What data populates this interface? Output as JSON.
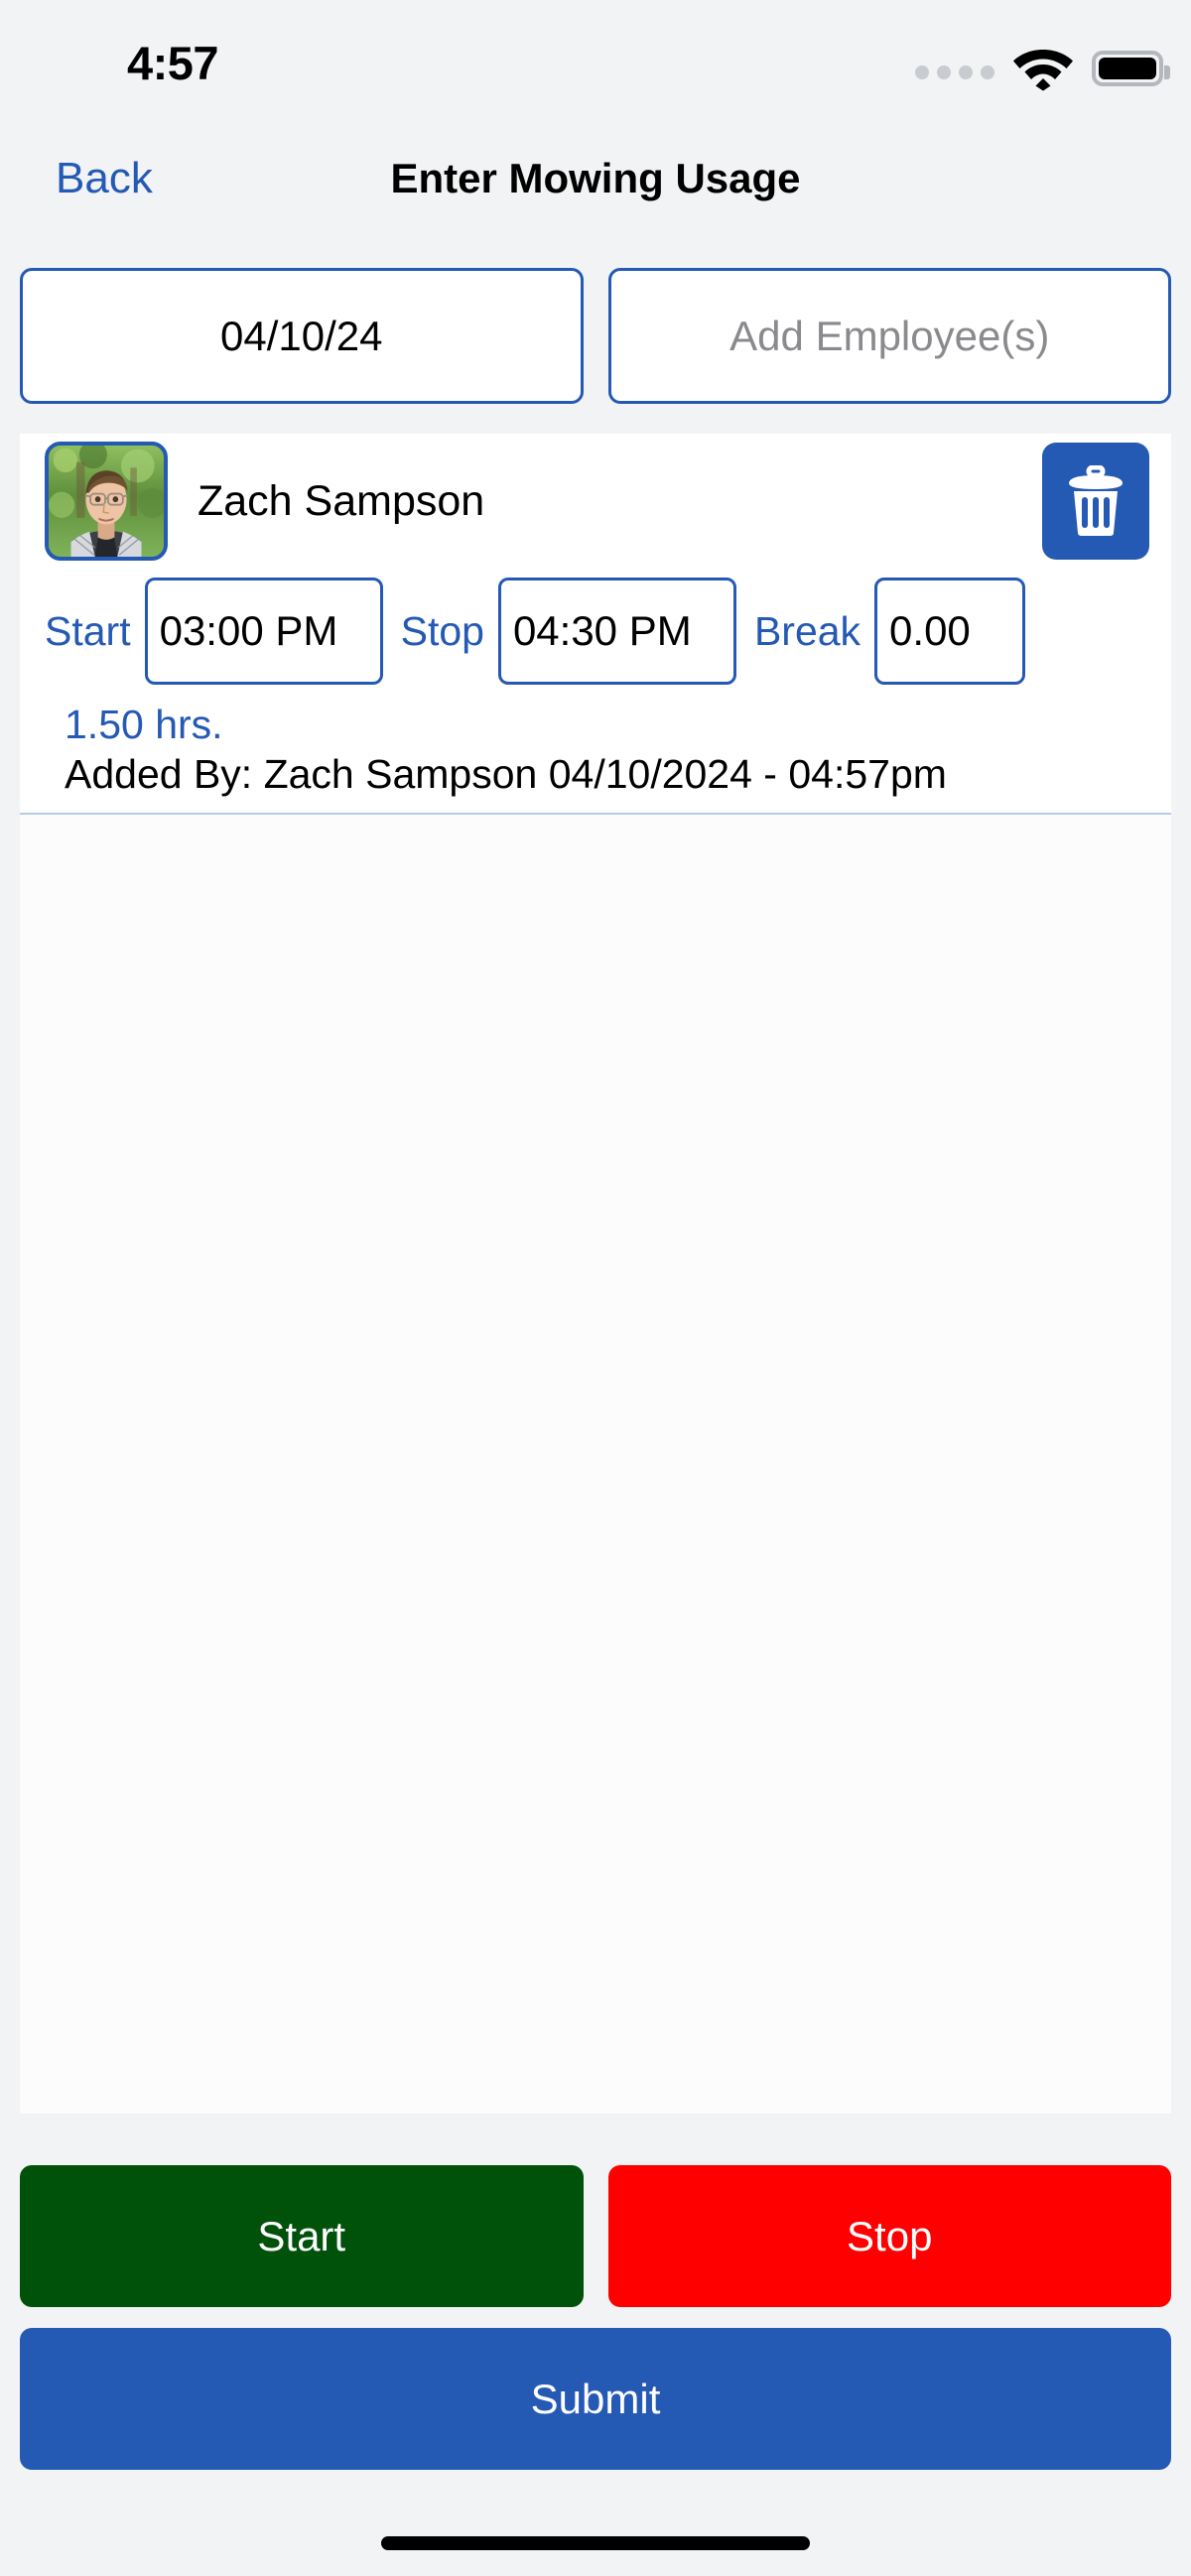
{
  "status_bar": {
    "time": "4:57",
    "cellular_icon": "signal-dots-icon",
    "wifi_icon": "wifi-icon",
    "battery_icon": "battery-full-icon"
  },
  "header": {
    "back_label": "Back",
    "title": "Enter Mowing Usage"
  },
  "top_row": {
    "date_value": "04/10/24",
    "add_employee_label": "Add Employee(s)"
  },
  "employee_entry": {
    "name": "Zach Sampson",
    "delete_icon": "trash-icon",
    "avatar_icon": "employee-avatar-photo",
    "start_label": "Start",
    "start_value": "03:00 PM",
    "stop_label": "Stop",
    "stop_value": "04:30 PM",
    "break_label": "Break",
    "break_value": "0.00",
    "hours_text": "1.50 hrs.",
    "added_by_text": "Added By: Zach Sampson 04/10/2024 - 04:57pm"
  },
  "actions": {
    "start_label": "Start",
    "stop_label": "Stop",
    "submit_label": "Submit"
  },
  "colors": {
    "accent_blue": "#2459B4",
    "start_green": "#00520A",
    "stop_red": "#FF0000",
    "page_background": "#F1F3F5",
    "placeholder_gray": "#8A8A8E"
  }
}
